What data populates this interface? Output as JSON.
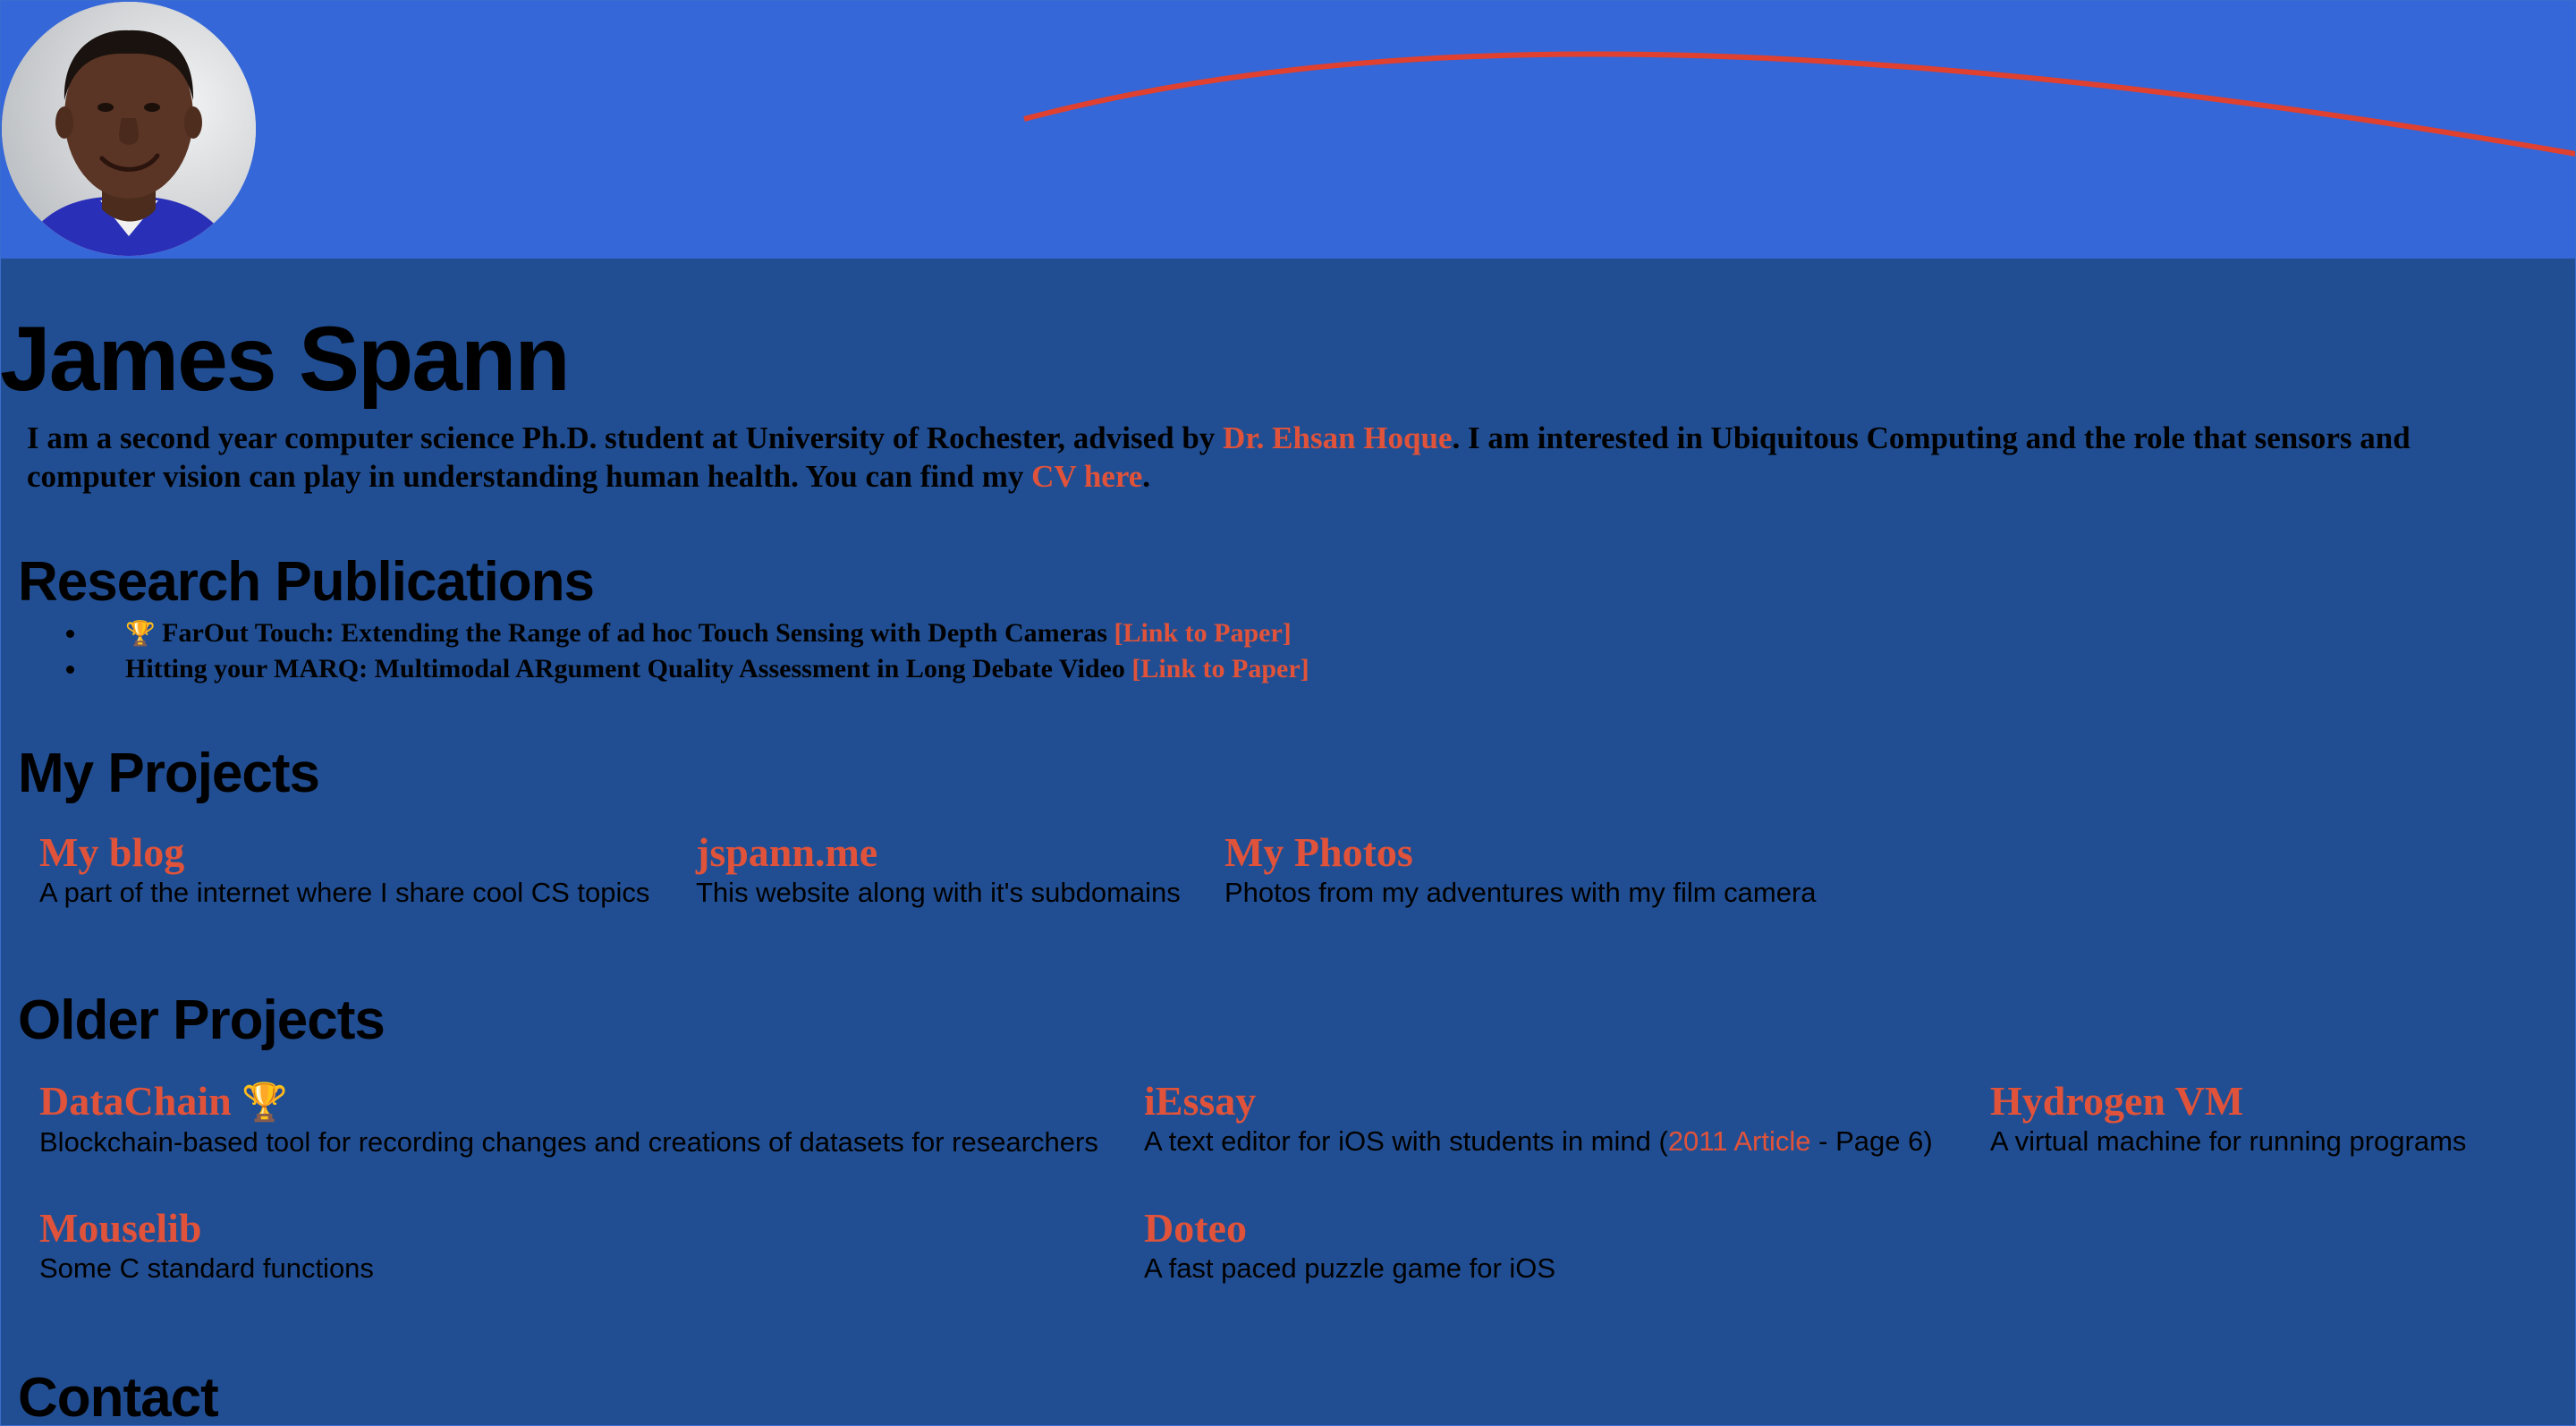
{
  "header": {
    "avatar_alt": "James Spann portrait"
  },
  "name": "James Spann",
  "bio": {
    "line1_a": "I am a second year computer science Ph.D. student at University of Rochester, advised by ",
    "advisor_link": "Dr. Ehsan Hoque",
    "line1_b": ". I am interested in Ubiquitous Computing and the role that sensors and",
    "line2_a": "computer vision can play in understanding human health. You can find my ",
    "cv_link": "CV here",
    "line2_b": "."
  },
  "publications": {
    "title": "Research Publications",
    "items": [
      {
        "icon": "🏆",
        "text": "FarOut Touch: Extending the Range of ad hoc Touch Sensing with Depth Cameras",
        "link": "[Link to Paper]"
      },
      {
        "icon": "",
        "text": "Hitting your MARQ: Multimodal ARgument Quality Assessment in Long Debate Video",
        "link": "[Link to Paper]"
      }
    ]
  },
  "projects": {
    "title": "My Projects",
    "items": [
      {
        "title": "My blog",
        "desc": "A part of the internet where I share cool CS topics"
      },
      {
        "title": "jspann.me",
        "desc": "This website along with it's subdomains"
      },
      {
        "title": "My Photos",
        "desc": "Photos from my adventures with my film camera"
      }
    ]
  },
  "older_projects": {
    "title": "Older Projects",
    "items": [
      {
        "title": "DataChain",
        "icon": "🏆",
        "desc": "Blockchain-based tool for recording changes and creations of datasets for researchers"
      },
      {
        "title": "iEssay",
        "desc_a": "A text editor for iOS with students in mind (",
        "desc_link": "2011 Article",
        "desc_b": " - Page 6)"
      },
      {
        "title": "Hydrogen VM",
        "desc": "A virtual machine for running programs"
      },
      {
        "title": "Mouselib",
        "desc": "Some C standard functions"
      },
      {
        "title": "Doteo",
        "desc": "A fast paced puzzle game for iOS"
      }
    ]
  },
  "contact": {
    "title": "Contact"
  },
  "colors": {
    "background": "#214e92",
    "banner": "#3567d8",
    "accent_link": "#e0533a",
    "banner_curve": "#e0402f"
  }
}
